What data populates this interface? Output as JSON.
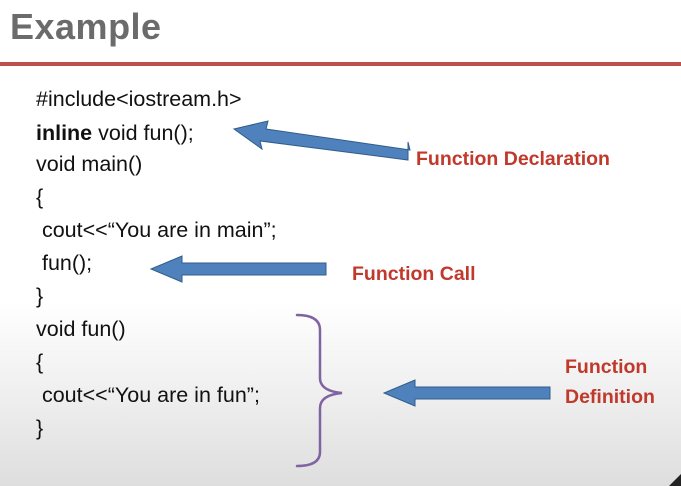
{
  "slide": {
    "title": "Example"
  },
  "code": {
    "line1": "#include<iostream.h>",
    "line2_keyword": "inline",
    "line2_rest": " void fun();",
    "line3": "void main()",
    "line4": "{",
    "line5": " cout<<“You are in main”;",
    "line6": " fun();",
    "line7": "}",
    "line8": "void fun()",
    "line9": "{",
    "line10": " cout<<“You are in fun”;",
    "line11": "}"
  },
  "labels": {
    "declaration": "Function Declaration",
    "call": "Function Call",
    "definition_line1": "Function",
    "definition_line2": "Definition"
  },
  "colors": {
    "accent_rule": "#c0504d",
    "label_text": "#c0392b",
    "arrow_fill": "#4f81bd",
    "brace": "#8064a2"
  }
}
